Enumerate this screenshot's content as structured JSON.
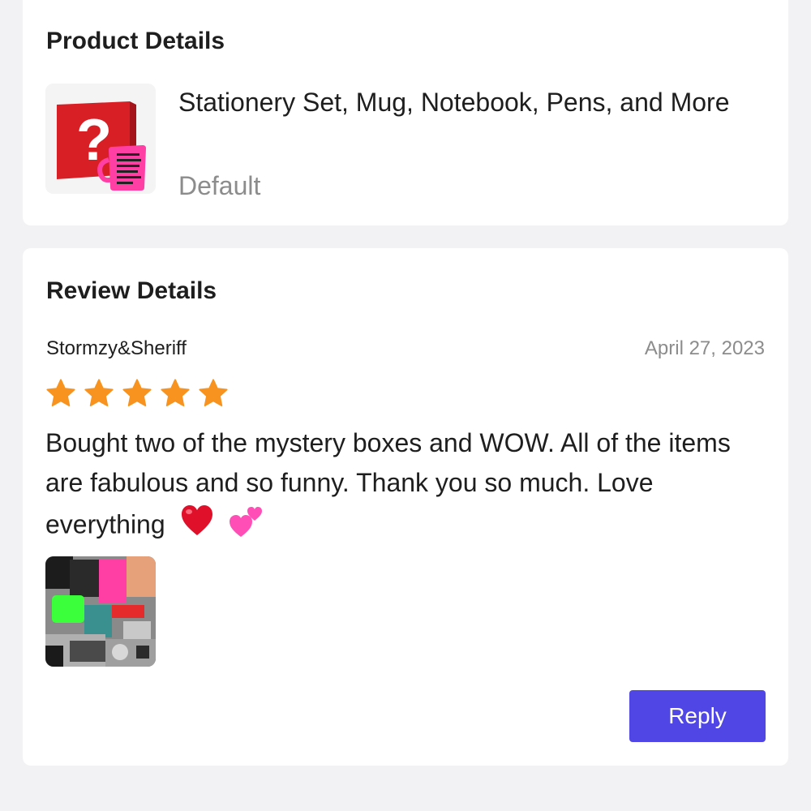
{
  "product_section": {
    "title": "Product Details",
    "product_name": "Stationery Set, Mug, Notebook, Pens, and More",
    "variant": "Default",
    "thumbnail_icon": "mystery-box-image"
  },
  "review_section": {
    "title": "Review Details",
    "reviewer": "Stormzy&Sheriff",
    "date": "April 27, 2023",
    "rating": 5,
    "rating_max": 5,
    "star_color": "#f7931e",
    "text": "Bought two of the mystery boxes and WOW. All of the items are fabulous and so funny. Thank you so much. Love everything",
    "emojis": [
      "heart-icon",
      "two-hearts-icon"
    ],
    "photo_icon": "review-photo-image",
    "reply_label": "Reply",
    "accent": "#4f46e5"
  }
}
